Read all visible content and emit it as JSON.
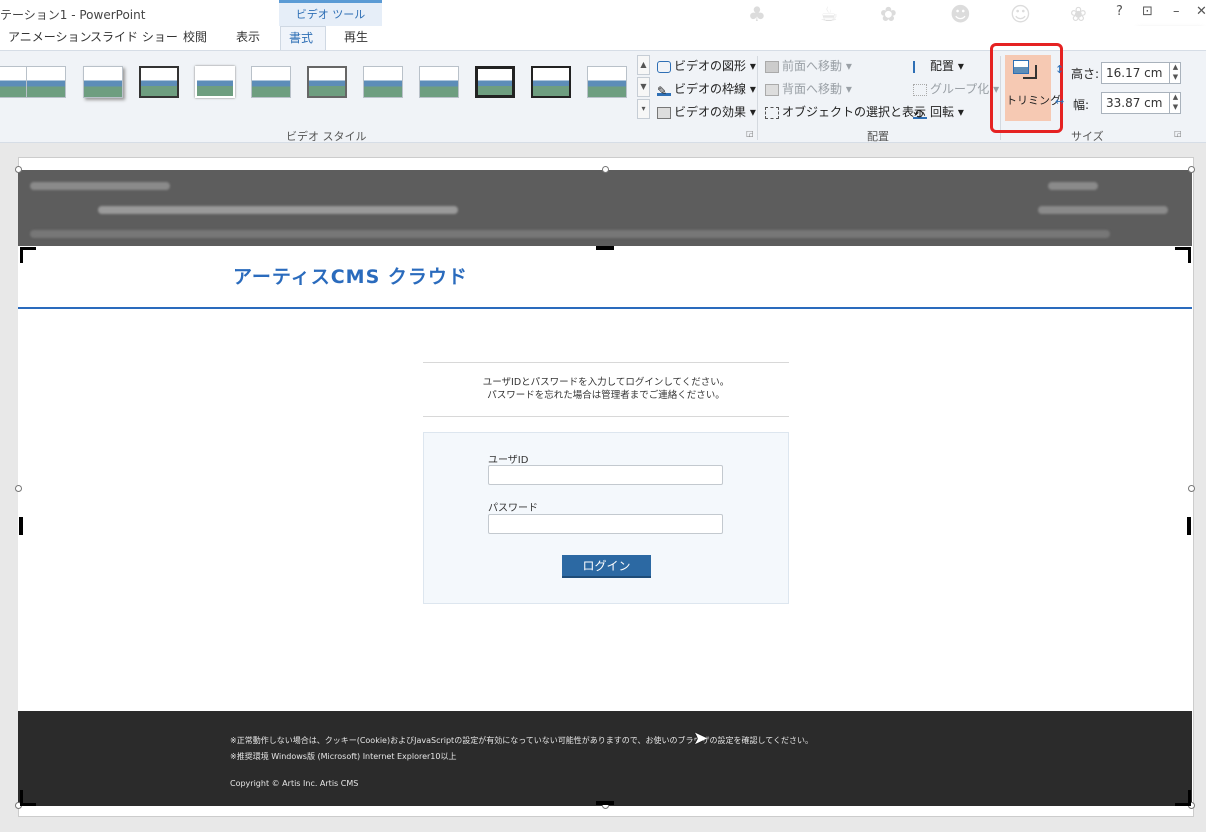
{
  "window": {
    "title": "テーション1 - PowerPoint",
    "controls": [
      "?",
      "⊡",
      "–",
      "✕"
    ]
  },
  "contextual_tab_header": "ビデオ ツール",
  "tabs": [
    {
      "label": "アニメーション"
    },
    {
      "label": "スライド ショー"
    },
    {
      "label": "校閲"
    },
    {
      "label": "表示"
    },
    {
      "label": "書式",
      "active": true
    },
    {
      "label": "再生"
    }
  ],
  "ribbon": {
    "video_styles": {
      "group_label": "ビデオ スタイル",
      "shape_label": "ビデオの図形",
      "border_label": "ビデオの枠線",
      "effects_label": "ビデオの効果"
    },
    "arrange": {
      "group_label": "配置",
      "bring_forward": "前面へ移動",
      "send_backward": "背面へ移動",
      "selection_pane": "オブジェクトの選択と表示",
      "align": "配置",
      "group": "グループ化",
      "rotate": "回転"
    },
    "size": {
      "group_label": "サイズ",
      "crop_label": "トリミング",
      "height_label": "高さ:",
      "height_value": "16.17 cm",
      "width_label": "幅:",
      "width_value": "33.87 cm"
    }
  },
  "slide": {
    "logo_text": "アーティスCMS クラウド",
    "instructions_line1": "ユーザIDとパスワードを入力してログインしてください。",
    "instructions_line2": "パスワードを忘れた場合は管理者までご連絡ください。",
    "userid_label": "ユーザID",
    "password_label": "パスワード",
    "login_button": "ログイン",
    "footer_line1": "※正常動作しない場合は、クッキー(Cookie)およびJavaScriptの設定が有効になっていない可能性がありますので、お使いのブラウザの設定を確認してください。",
    "footer_line2": "※推奨環境 Windows版 (Microsoft) Internet Explorer10以上",
    "footer_line3": "Copyright © Artis Inc. Artis CMS"
  },
  "colors": {
    "accent": "#2e6fb5",
    "highlight": "#e52222",
    "crop_fill": "#f6c9b3",
    "cms_blue": "#2a6bbd",
    "footer_bg": "#2b2b2b"
  }
}
